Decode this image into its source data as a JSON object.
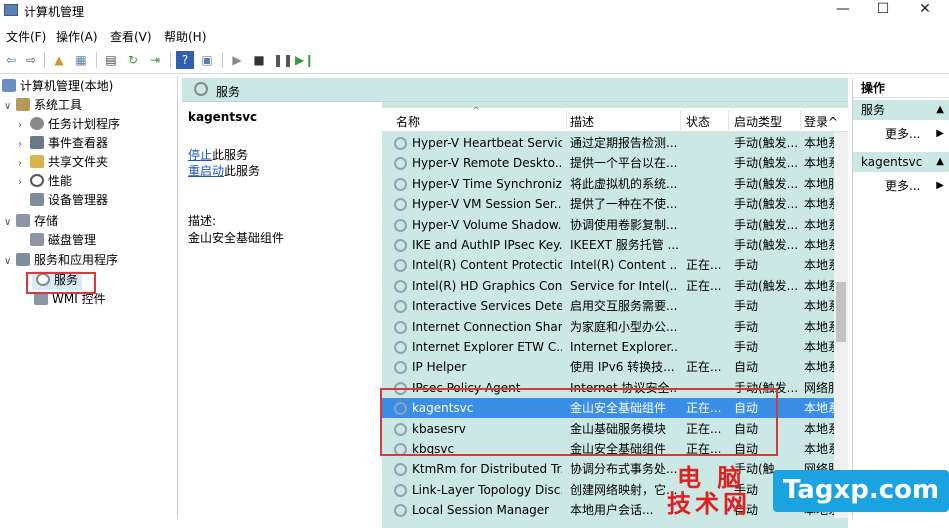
{
  "window": {
    "title": "计算机管理",
    "minimize": "—",
    "maximize": "☐",
    "close": "✕"
  },
  "menu": [
    "文件(F)",
    "操作(A)",
    "查看(V)",
    "帮助(H)"
  ],
  "tree": {
    "root": "计算机管理(本地)",
    "system_tools": "系统工具",
    "task_scheduler": "任务计划程序",
    "event_viewer": "事件查看器",
    "shared_folders": "共享文件夹",
    "performance": "性能",
    "device_manager": "设备管理器",
    "storage": "存储",
    "disk_management": "磁盘管理",
    "services_apps": "服务和应用程序",
    "services": "服务",
    "wmi": "WMI 控件"
  },
  "center_header": "服务",
  "detail": {
    "service_name": "kagentsvc",
    "stop_link": "停止",
    "stop_suffix": "此服务",
    "restart_link": "重启动",
    "restart_suffix": "此服务",
    "desc_label": "描述:",
    "desc_text": "金山安全基础组件"
  },
  "columns": [
    "名称",
    "描述",
    "状态",
    "启动类型",
    "登录为"
  ],
  "columns_shown": [
    "名称",
    "描述",
    "状态",
    "启动类型",
    "登录^"
  ],
  "rows": [
    {
      "name": "Hyper-V Heartbeat Service",
      "desc": "通过定期报告检测...",
      "status": "",
      "startup": "手动(触发...",
      "logon": "本地系"
    },
    {
      "name": "Hyper-V Remote Deskto...",
      "desc": "提供一个平台以在...",
      "status": "",
      "startup": "手动(触发...",
      "logon": "本地系"
    },
    {
      "name": "Hyper-V Time Synchroniz...",
      "desc": "将此虚拟机的系统...",
      "status": "",
      "startup": "手动(触发...",
      "logon": "本地服"
    },
    {
      "name": "Hyper-V VM Session Ser...",
      "desc": "提供了一种在不使...",
      "status": "",
      "startup": "手动(触发...",
      "logon": "本地系"
    },
    {
      "name": "Hyper-V Volume Shadow...",
      "desc": "协调使用卷影复制...",
      "status": "",
      "startup": "手动(触发...",
      "logon": "本地系"
    },
    {
      "name": "IKE and AuthIP IPsec Key...",
      "desc": "IKEEXT 服务托管 ...",
      "status": "",
      "startup": "手动(触发...",
      "logon": "本地系"
    },
    {
      "name": "Intel(R) Content Protectio...",
      "desc": "Intel(R) Content ...",
      "status": "正在...",
      "startup": "手动",
      "logon": "本地系"
    },
    {
      "name": "Intel(R) HD Graphics Con...",
      "desc": "Service for Intel(...",
      "status": "正在...",
      "startup": "手动(触发...",
      "logon": "本地系"
    },
    {
      "name": "Interactive Services Dete...",
      "desc": "启用交互服务需要...",
      "status": "",
      "startup": "手动",
      "logon": "本地系"
    },
    {
      "name": "Internet Connection Shari...",
      "desc": "为家庭和小型办公...",
      "status": "",
      "startup": "手动",
      "logon": "本地系"
    },
    {
      "name": "Internet Explorer ETW C...",
      "desc": "Internet Explorer...",
      "status": "",
      "startup": "手动",
      "logon": "本地系"
    },
    {
      "name": "IP Helper",
      "desc": "使用 IPv6 转换技...",
      "status": "正在...",
      "startup": "自动",
      "logon": "本地系"
    },
    {
      "name": "IPsec Policy Agent",
      "desc": "Internet 协议安全...",
      "status": "",
      "startup": "手动(触发...",
      "logon": "网络服"
    },
    {
      "name": "kagentsvc",
      "desc": "金山安全基础组件",
      "status": "正在...",
      "startup": "自动",
      "logon": "本地系"
    },
    {
      "name": "kbasesrv",
      "desc": "金山基础服务模块",
      "status": "正在...",
      "startup": "自动",
      "logon": "本地系"
    },
    {
      "name": "kbqsvc",
      "desc": "金山安全基础组件",
      "status": "正在...",
      "startup": "自动",
      "logon": "本地系"
    },
    {
      "name": "KtmRm for Distributed Tr...",
      "desc": "协调分布式事务处...",
      "status": "",
      "startup": "手动(触...",
      "logon": "网络服"
    },
    {
      "name": "Link-Layer Topology Disc...",
      "desc": "创建网络映射，它...",
      "status": "",
      "startup": "手动",
      "logon": "本地服"
    },
    {
      "name": "Local Session Manager",
      "desc": "本地用户会话...",
      "status": "",
      "startup": "自动",
      "logon": "本地系"
    }
  ],
  "actions": {
    "title": "操作",
    "section1": "服务",
    "more1": "更多...",
    "section2": "kagentsvc",
    "more2": "更多..."
  },
  "watermark": {
    "cn_top": "电 脑",
    "cn_bottom": "技术网",
    "en": "Tagxp.com"
  }
}
